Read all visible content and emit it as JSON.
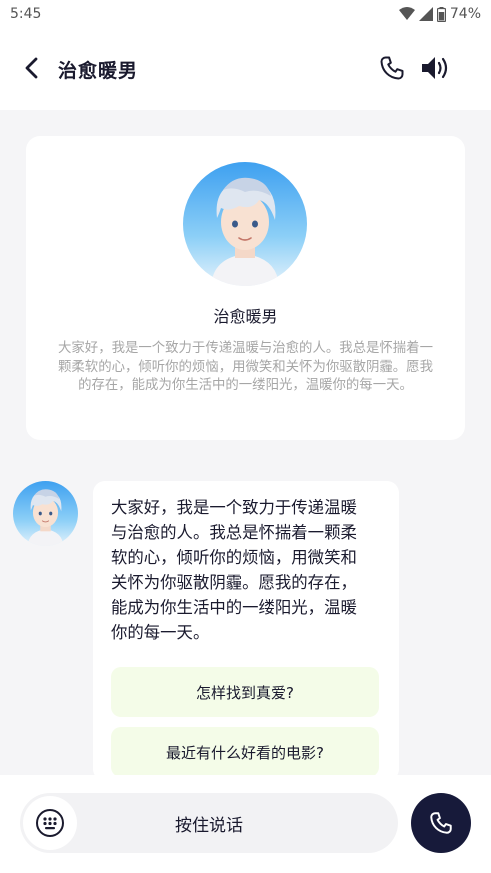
{
  "status_bar": {
    "time": "5:45",
    "battery": "74%",
    "icons": [
      "wifi-icon",
      "signal-icon",
      "battery-icon"
    ]
  },
  "header": {
    "title": "治愈暖男",
    "back_icon": "back-arrow-icon",
    "actions": [
      "phone-icon",
      "speaker-icon"
    ]
  },
  "profile": {
    "name": "治愈暖男",
    "intro": "大家好，我是一个致力于传递温暖与治愈的人。我总是怀揣着一颗柔软的心，倾听你的烦恼，用微笑和关怀为你驱散阴霾。愿我的存在，能成为你生活中的一缕阳光，温暖你的每一天。"
  },
  "message": {
    "text": "大家好，我是一个致力于传递温暖与治愈的人。我总是怀揣着一颗柔软的心，倾听你的烦恼，用微笑和关怀为你驱散阴霾。愿我的存在，能成为你生活中的一缕阳光，温暖你的每一天。",
    "suggestions": [
      "怎样找到真爱?",
      "最近有什么好看的电影?"
    ]
  },
  "input": {
    "hold_to_talk": "按住说话",
    "keyboard_icon": "keyboard-icon",
    "call_icon": "phone-icon"
  },
  "colors": {
    "accent_dark": "#171a3a",
    "suggestion_bg": "#f4fce8",
    "page_bg": "#f5f5f7",
    "intro_text": "#a6a6a6"
  }
}
